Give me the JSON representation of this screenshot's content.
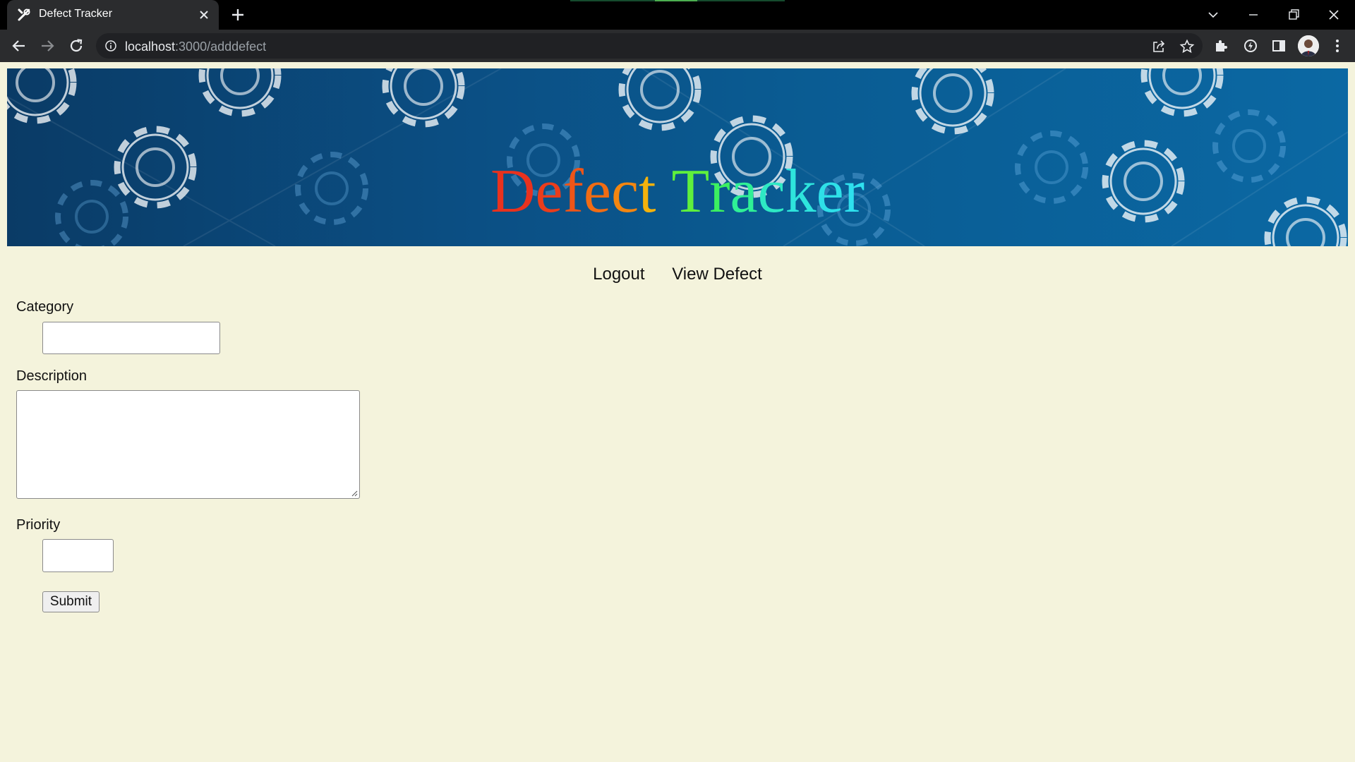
{
  "browser": {
    "tab_title": "Defect Tracker",
    "url_host": "localhost",
    "url_path": ":3000/adddefect"
  },
  "banner": {
    "title_letters": [
      "D",
      "e",
      "f",
      "e",
      "c",
      "t",
      " ",
      "T",
      "r",
      "a",
      "c",
      "k",
      "e",
      "r"
    ],
    "title_colors": [
      "#e8321e",
      "#ea3d1c",
      "#ee5518",
      "#f06c14",
      "#f38611",
      "#f4b20c",
      "#ffffff",
      "#5ff03c",
      "#3cf060",
      "#2ff096",
      "#2ee9c4",
      "#2ee4dc",
      "#2ee0e8",
      "#2ee0ee"
    ]
  },
  "nav": {
    "logout": "Logout",
    "view_defect": "View Defect"
  },
  "form": {
    "category_label": "Category",
    "category_value": "",
    "description_label": "Description",
    "description_value": "",
    "priority_label": "Priority",
    "priority_value": "",
    "submit_label": "Submit"
  },
  "icons": {
    "favicon": "tools-icon",
    "back": "back-arrow-icon",
    "forward": "forward-arrow-icon",
    "reload": "reload-icon",
    "site_info": "info-icon",
    "share": "share-icon",
    "bookmark": "star-icon",
    "extensions": "puzzle-icon",
    "extension_2": "lightning-icon",
    "side_panel": "side-panel-icon",
    "menu": "kebab-menu-icon"
  }
}
